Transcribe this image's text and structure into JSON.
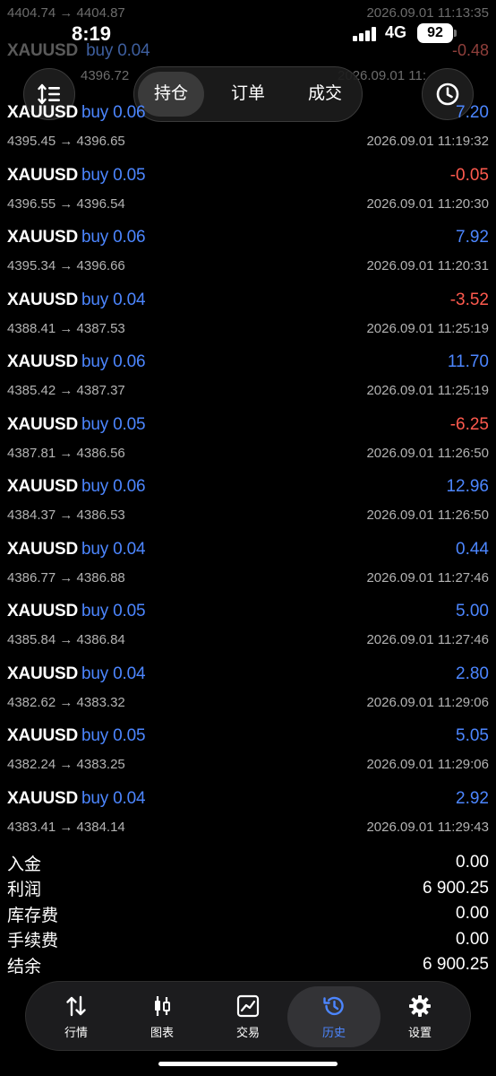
{
  "status_bar": {
    "time": "8:19",
    "network": "4G",
    "battery": "92"
  },
  "header": {
    "tabs": [
      {
        "label": "持仓",
        "active": true
      },
      {
        "label": "订单",
        "active": false
      },
      {
        "label": "成交",
        "active": false
      }
    ]
  },
  "ghost_rows": [
    {
      "prices": "4404.74 → 4404.87",
      "time": "2026.09.01 11:13:35"
    },
    {
      "symbol": "XAUUSD",
      "side": "buy 0.04",
      "profit": "-0.48"
    },
    {
      "prices": "4396.72",
      "time": "2026.09.01 11:"
    },
    {
      "symbol": "XAUUSD",
      "side": "buy 0.06",
      "profit": "7.20"
    }
  ],
  "deals": [
    {
      "symbol": "XAUUSD",
      "side": "buy 0.06",
      "profit": "7.20",
      "prices": "4395.45 → 4396.65",
      "time": "2026.09.01 11:19:32",
      "positive": true,
      "partial": true
    },
    {
      "symbol": "XAUUSD",
      "side": "buy 0.05",
      "profit": "-0.05",
      "prices": "4396.55 → 4396.54",
      "time": "2026.09.01 11:20:30",
      "positive": false
    },
    {
      "symbol": "XAUUSD",
      "side": "buy 0.06",
      "profit": "7.92",
      "prices": "4395.34 → 4396.66",
      "time": "2026.09.01 11:20:31",
      "positive": true
    },
    {
      "symbol": "XAUUSD",
      "side": "buy 0.04",
      "profit": "-3.52",
      "prices": "4388.41 → 4387.53",
      "time": "2026.09.01 11:25:19",
      "positive": false
    },
    {
      "symbol": "XAUUSD",
      "side": "buy 0.06",
      "profit": "11.70",
      "prices": "4385.42 → 4387.37",
      "time": "2026.09.01 11:25:19",
      "positive": true
    },
    {
      "symbol": "XAUUSD",
      "side": "buy 0.05",
      "profit": "-6.25",
      "prices": "4387.81 → 4386.56",
      "time": "2026.09.01 11:26:50",
      "positive": false
    },
    {
      "symbol": "XAUUSD",
      "side": "buy 0.06",
      "profit": "12.96",
      "prices": "4384.37 → 4386.53",
      "time": "2026.09.01 11:26:50",
      "positive": true
    },
    {
      "symbol": "XAUUSD",
      "side": "buy 0.04",
      "profit": "0.44",
      "prices": "4386.77 → 4386.88",
      "time": "2026.09.01 11:27:46",
      "positive": true
    },
    {
      "symbol": "XAUUSD",
      "side": "buy 0.05",
      "profit": "5.00",
      "prices": "4385.84 → 4386.84",
      "time": "2026.09.01 11:27:46",
      "positive": true
    },
    {
      "symbol": "XAUUSD",
      "side": "buy 0.04",
      "profit": "2.80",
      "prices": "4382.62 → 4383.32",
      "time": "2026.09.01 11:29:06",
      "positive": true
    },
    {
      "symbol": "XAUUSD",
      "side": "buy 0.05",
      "profit": "5.05",
      "prices": "4382.24 → 4383.25",
      "time": "2026.09.01 11:29:06",
      "positive": true
    },
    {
      "symbol": "XAUUSD",
      "side": "buy 0.04",
      "profit": "2.92",
      "prices": "4383.41 → 4384.14",
      "time": "2026.09.01 11:29:43",
      "positive": true
    }
  ],
  "summary": [
    {
      "label": "入金",
      "value": "0.00"
    },
    {
      "label": "利润",
      "value": "6 900.25"
    },
    {
      "label": "库存费",
      "value": "0.00"
    },
    {
      "label": "手续费",
      "value": "0.00"
    },
    {
      "label": "结余",
      "value": "6 900.25"
    }
  ],
  "tab_bar": [
    {
      "label": "行情",
      "icon": "quotes-arrows-icon",
      "active": false
    },
    {
      "label": "图表",
      "icon": "candlestick-chart-icon",
      "active": false
    },
    {
      "label": "交易",
      "icon": "trade-chart-icon",
      "active": false
    },
    {
      "label": "历史",
      "icon": "history-clock-icon",
      "active": true
    },
    {
      "label": "设置",
      "icon": "gear-icon",
      "active": false
    }
  ],
  "colors": {
    "positive": "#4c86ff",
    "negative": "#ff5a4e",
    "muted": "#b3b3b3",
    "background": "#000000"
  }
}
